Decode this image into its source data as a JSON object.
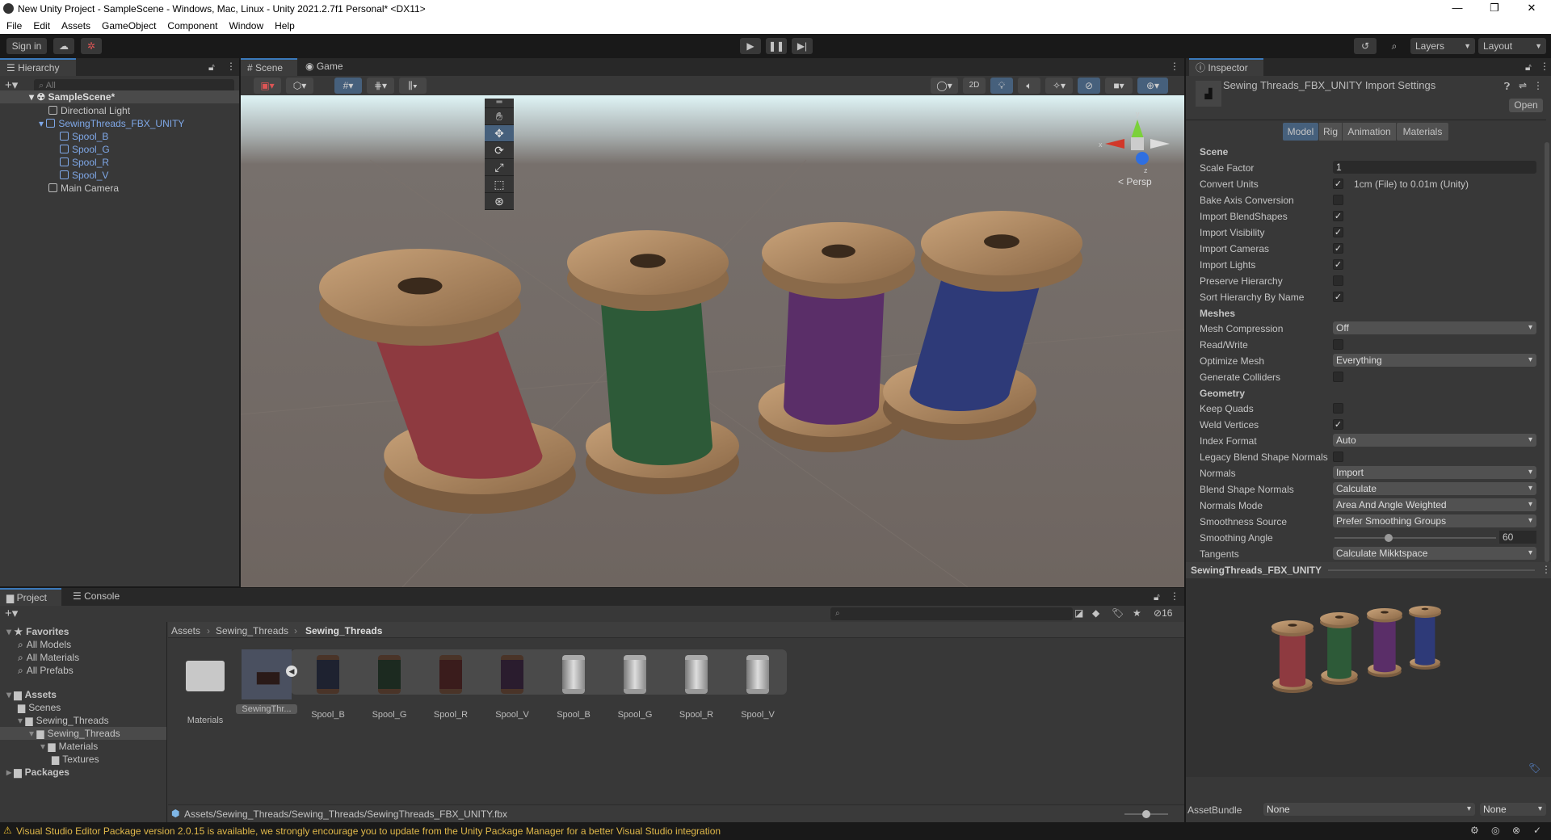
{
  "window": {
    "title": "New Unity Project - SampleScene - Windows, Mac, Linux - Unity 2021.2.7f1 Personal* <DX11>",
    "minimize": "—",
    "maximize": "❐",
    "close": "✕"
  },
  "menu": [
    "File",
    "Edit",
    "Assets",
    "GameObject",
    "Component",
    "Window",
    "Help"
  ],
  "toolbar": {
    "sign_in": "Sign in",
    "layers": "Layers",
    "layout": "Layout"
  },
  "hierarchy": {
    "tab": "Hierarchy",
    "search_placeholder": "All",
    "scene": "SampleScene*",
    "items": [
      {
        "label": "Directional Light",
        "level": 1,
        "selected": false
      },
      {
        "label": "SewingThreads_FBX_UNITY",
        "level": 1,
        "selected": true
      },
      {
        "label": "Spool_B",
        "level": 2,
        "selected": true
      },
      {
        "label": "Spool_G",
        "level": 2,
        "selected": true
      },
      {
        "label": "Spool_R",
        "level": 2,
        "selected": true
      },
      {
        "label": "Spool_V",
        "level": 2,
        "selected": true
      },
      {
        "label": "Main Camera",
        "level": 1,
        "selected": false
      }
    ]
  },
  "scene": {
    "tabs": [
      "Scene",
      "Game"
    ],
    "mode_2d": "2D",
    "persp": "< Persp",
    "gizmo_axes": [
      "y",
      "x",
      "z"
    ],
    "spool_colors": [
      "#8e3a40",
      "#2d5a38",
      "#5a2e68",
      "#2e3a78"
    ]
  },
  "inspector": {
    "tab": "Inspector",
    "title": "Sewing Threads_FBX_UNITY Import Settings",
    "open": "Open",
    "tabs": [
      "Model",
      "Rig",
      "Animation",
      "Materials"
    ],
    "rows": [
      {
        "type": "header",
        "label": "Scene"
      },
      {
        "type": "text",
        "label": "Scale Factor",
        "value": "1"
      },
      {
        "type": "check",
        "label": "Convert Units",
        "checked": true,
        "note": "1cm (File) to 0.01m (Unity)"
      },
      {
        "type": "check",
        "label": "Bake Axis Conversion",
        "checked": false
      },
      {
        "type": "check",
        "label": "Import BlendShapes",
        "checked": true
      },
      {
        "type": "check",
        "label": "Import Visibility",
        "checked": true
      },
      {
        "type": "check",
        "label": "Import Cameras",
        "checked": true
      },
      {
        "type": "check",
        "label": "Import Lights",
        "checked": true
      },
      {
        "type": "check",
        "label": "Preserve Hierarchy",
        "checked": false
      },
      {
        "type": "check",
        "label": "Sort Hierarchy By Name",
        "checked": true
      },
      {
        "type": "header",
        "label": "Meshes"
      },
      {
        "type": "dropdown",
        "label": "Mesh Compression",
        "value": "Off"
      },
      {
        "type": "check",
        "label": "Read/Write",
        "checked": false
      },
      {
        "type": "dropdown",
        "label": "Optimize Mesh",
        "value": "Everything"
      },
      {
        "type": "check",
        "label": "Generate Colliders",
        "checked": false
      },
      {
        "type": "header",
        "label": "Geometry"
      },
      {
        "type": "check",
        "label": "Keep Quads",
        "checked": false
      },
      {
        "type": "check",
        "label": "Weld Vertices",
        "checked": true
      },
      {
        "type": "dropdown",
        "label": "Index Format",
        "value": "Auto"
      },
      {
        "type": "check",
        "label": "Legacy Blend Shape Normals",
        "checked": false
      },
      {
        "type": "dropdown",
        "label": "Normals",
        "value": "Import"
      },
      {
        "type": "dropdown",
        "label": "Blend Shape Normals",
        "value": "Calculate"
      },
      {
        "type": "dropdown",
        "label": "Normals Mode",
        "value": "Area And Angle Weighted"
      },
      {
        "type": "dropdown",
        "label": "Smoothness Source",
        "value": "Prefer Smoothing Groups"
      },
      {
        "type": "slider",
        "label": "Smoothing Angle",
        "value": "60",
        "fraction": 0.333
      },
      {
        "type": "dropdown",
        "label": "Tangents",
        "value": "Calculate Mikktspace"
      }
    ],
    "preview_title": "SewingThreads_FBX_UNITY",
    "assetbundle_label": "AssetBundle",
    "assetbundle_value": "None",
    "assetbundle_variant": "None"
  },
  "project": {
    "tabs": [
      "Project",
      "Console"
    ],
    "hidden_count": "16",
    "tree": [
      {
        "label": "Favorites",
        "level": 0,
        "bold": true,
        "icon": "star"
      },
      {
        "label": "All Models",
        "level": 1,
        "icon": "search"
      },
      {
        "label": "All Materials",
        "level": 1,
        "icon": "search"
      },
      {
        "label": "All Prefabs",
        "level": 1,
        "icon": "search"
      },
      {
        "label": "Assets",
        "level": 0,
        "bold": true,
        "icon": "folder",
        "gap": true
      },
      {
        "label": "Scenes",
        "level": 1,
        "icon": "folder"
      },
      {
        "label": "Sewing_Threads",
        "level": 1,
        "icon": "folder"
      },
      {
        "label": "Sewing_Threads",
        "level": 2,
        "icon": "folder",
        "selected": true
      },
      {
        "label": "Materials",
        "level": 3,
        "icon": "folder"
      },
      {
        "label": "Textures",
        "level": 4,
        "icon": "folder"
      },
      {
        "label": "Packages",
        "level": 0,
        "bold": true,
        "icon": "folder"
      }
    ],
    "breadcrumb": [
      "Assets",
      "Sewing_Threads",
      "Sewing_Threads"
    ],
    "assets": [
      {
        "label": "Materials",
        "kind": "folder"
      },
      {
        "label": "SewingThr...",
        "kind": "model"
      },
      {
        "label": "Spool_B",
        "kind": "mesh-dark",
        "color": "#1e2230"
      },
      {
        "label": "Spool_G",
        "kind": "mesh-dark",
        "color": "#1c2a20"
      },
      {
        "label": "Spool_R",
        "kind": "mesh-dark",
        "color": "#3a1c1c"
      },
      {
        "label": "Spool_V",
        "kind": "mesh-dark",
        "color": "#2a1c2e"
      },
      {
        "label": "Spool_B",
        "kind": "mesh-light"
      },
      {
        "label": "Spool_G",
        "kind": "mesh-light"
      },
      {
        "label": "Spool_R",
        "kind": "mesh-light"
      },
      {
        "label": "Spool_V",
        "kind": "mesh-light"
      }
    ],
    "path": "Assets/Sewing_Threads/Sewing_Threads/SewingThreads_FBX_UNITY.fbx"
  },
  "status": {
    "message": "Visual Studio Editor Package version 2.0.15 is available, we strongly encourage you to update from the Unity Package Manager for a better Visual Studio integration",
    "color": "#e0b84a"
  }
}
